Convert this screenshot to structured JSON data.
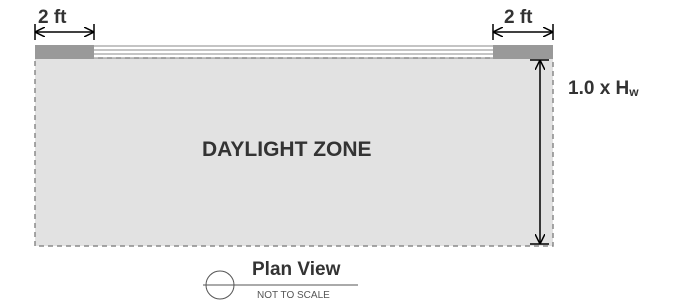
{
  "diagram": {
    "left_dimension": "2 ft",
    "right_dimension": "2 ft",
    "height_label": "1.0 x H",
    "height_label_subscript": "w",
    "zone_label": "DAYLIGHT ZONE",
    "plan_title": "Plan View",
    "plan_subtitle": "NOT TO SCALE"
  },
  "colors": {
    "zone_fill": "#e2e2e2",
    "wall_fill": "#999999",
    "text": "#333333"
  }
}
